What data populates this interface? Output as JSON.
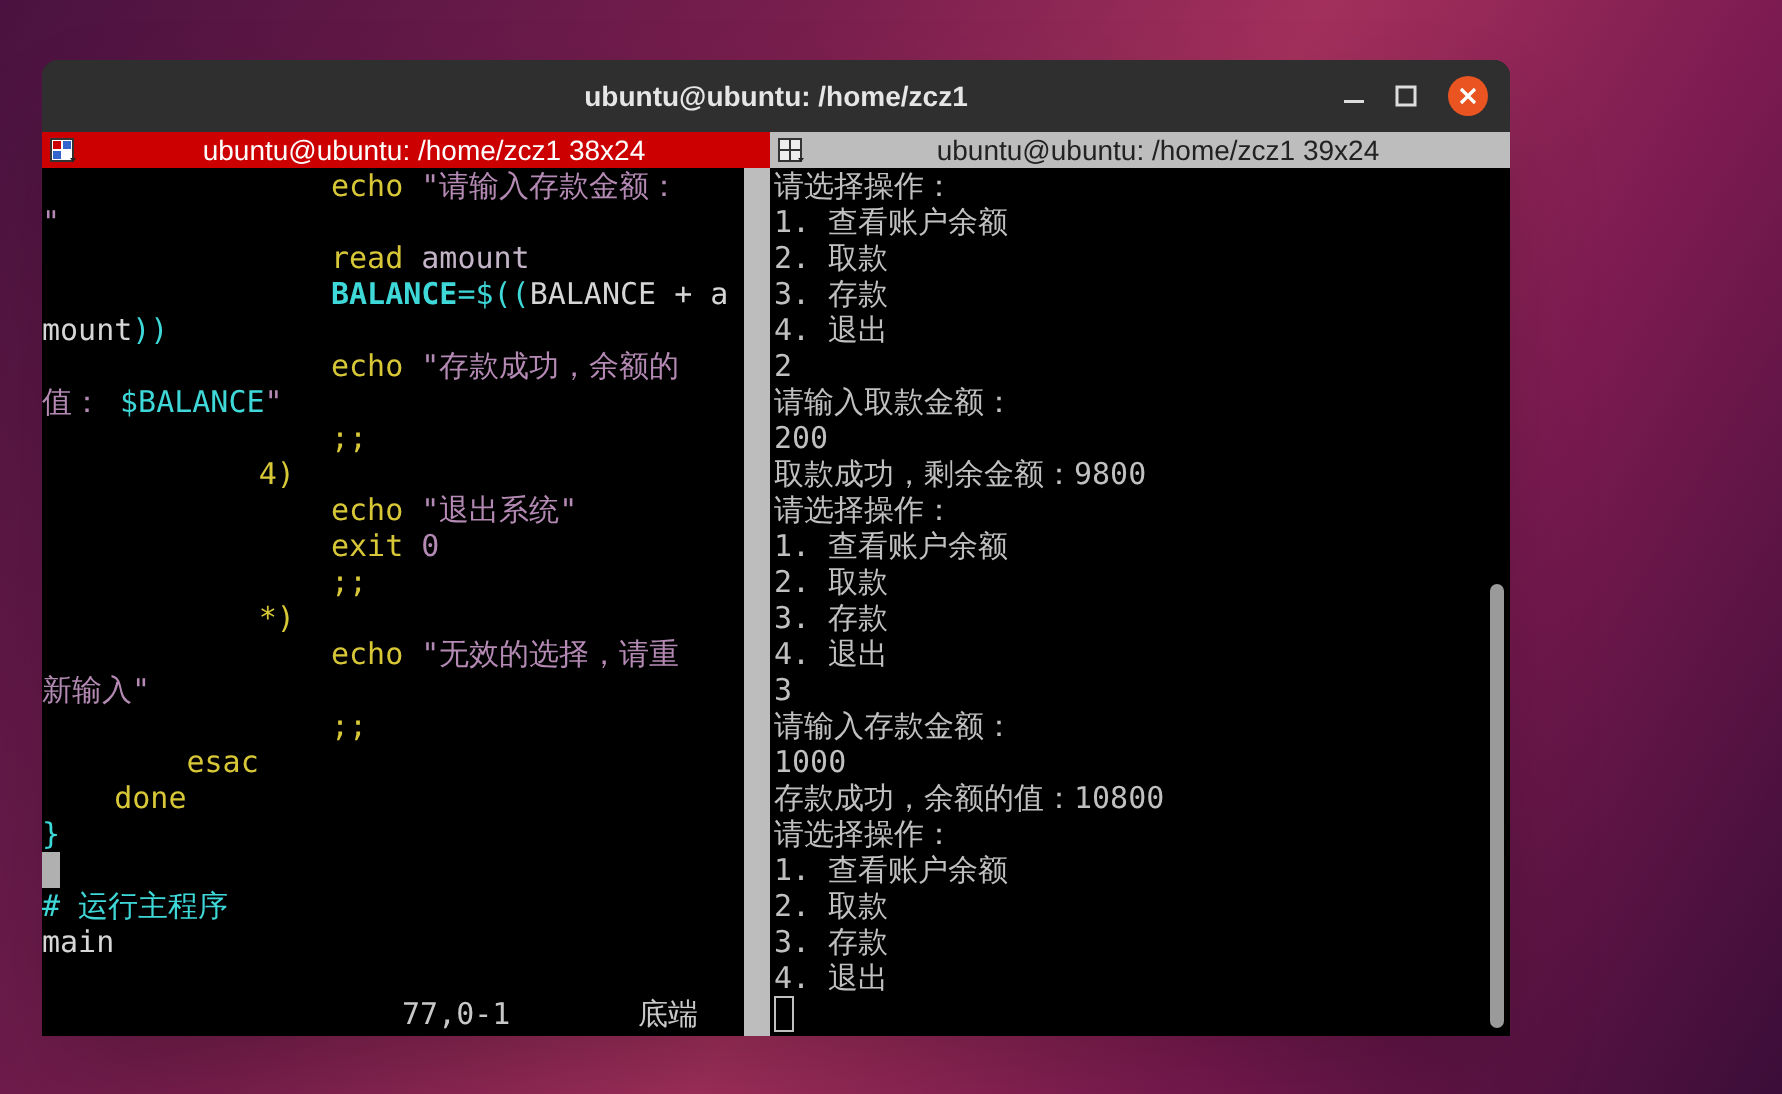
{
  "window": {
    "title": "ubuntu@ubuntu: /home/zcz1"
  },
  "left_pane": {
    "title": "ubuntu@ubuntu: /home/zcz1 38x24",
    "focused": true,
    "lines": [
      {
        "segments": [
          {
            "text": "                echo",
            "kind": "keyword"
          },
          {
            "text": " \"请输入存款金额：",
            "kind": "string"
          }
        ]
      },
      {
        "segments": [
          {
            "text": "\"",
            "kind": "string"
          }
        ]
      },
      {
        "segments": [
          {
            "text": "                read",
            "kind": "keyword"
          },
          {
            "text": " amount",
            "kind": "argument"
          }
        ]
      },
      {
        "segments": [
          {
            "text": "                BALANCE",
            "kind": "variable_bold"
          },
          {
            "text": "=$((",
            "kind": "variable"
          },
          {
            "text": "BALANCE + a",
            "kind": "plain"
          }
        ]
      },
      {
        "segments": [
          {
            "text": "mount",
            "kind": "plain"
          },
          {
            "text": "))",
            "kind": "variable"
          }
        ]
      },
      {
        "segments": [
          {
            "text": "                echo",
            "kind": "keyword"
          },
          {
            "text": " \"存款成功，余额的",
            "kind": "string"
          }
        ]
      },
      {
        "segments": [
          {
            "text": "值：",
            "kind": "string"
          },
          {
            "text": " $BALANCE",
            "kind": "variable"
          },
          {
            "text": "\"",
            "kind": "string"
          }
        ]
      },
      {
        "segments": [
          {
            "text": "                ;;",
            "kind": "keyword"
          }
        ]
      },
      {
        "segments": [
          {
            "text": "            4)",
            "kind": "keyword"
          }
        ]
      },
      {
        "segments": [
          {
            "text": "                echo",
            "kind": "keyword"
          },
          {
            "text": " \"退出系统\"",
            "kind": "string"
          }
        ]
      },
      {
        "segments": [
          {
            "text": "                exit",
            "kind": "keyword"
          },
          {
            "text": " 0",
            "kind": "number"
          }
        ]
      },
      {
        "segments": [
          {
            "text": "                ;;",
            "kind": "keyword"
          }
        ]
      },
      {
        "segments": [
          {
            "text": "            *)",
            "kind": "keyword"
          }
        ]
      },
      {
        "segments": [
          {
            "text": "                echo",
            "kind": "keyword"
          },
          {
            "text": " \"无效的选择，请重",
            "kind": "string"
          }
        ]
      },
      {
        "segments": [
          {
            "text": "新输入\"",
            "kind": "string"
          }
        ]
      },
      {
        "segments": [
          {
            "text": "                ;;",
            "kind": "keyword"
          }
        ]
      },
      {
        "segments": [
          {
            "text": "        esac",
            "kind": "keyword"
          }
        ]
      },
      {
        "segments": [
          {
            "text": "    done",
            "kind": "keyword"
          }
        ]
      },
      {
        "segments": [
          {
            "text": "}",
            "kind": "variable"
          }
        ]
      },
      {
        "cursor": true
      },
      {
        "segments": [
          {
            "text": "# 运行主程序",
            "kind": "comment"
          }
        ]
      },
      {
        "segments": [
          {
            "text": "main",
            "kind": "plain"
          }
        ]
      }
    ],
    "status": {
      "position": "77,0-1",
      "scroll": "底端"
    }
  },
  "right_pane": {
    "title": "ubuntu@ubuntu: /home/zcz1 39x24",
    "focused": false,
    "lines": [
      "请选择操作：",
      "1. 查看账户余额",
      "2. 取款",
      "3. 存款",
      "4. 退出",
      "2",
      "请输入取款金额：",
      "200",
      "取款成功，剩余金额：9800",
      "请选择操作：",
      "1. 查看账户余额",
      "2. 取款",
      "3. 存款",
      "4. 退出",
      "3",
      "请输入存款金额：",
      "1000",
      "存款成功，余额的值：10800",
      "请选择操作：",
      "1. 查看账户余额",
      "2. 取款",
      "3. 存款",
      "4. 退出"
    ],
    "cursor": true
  }
}
